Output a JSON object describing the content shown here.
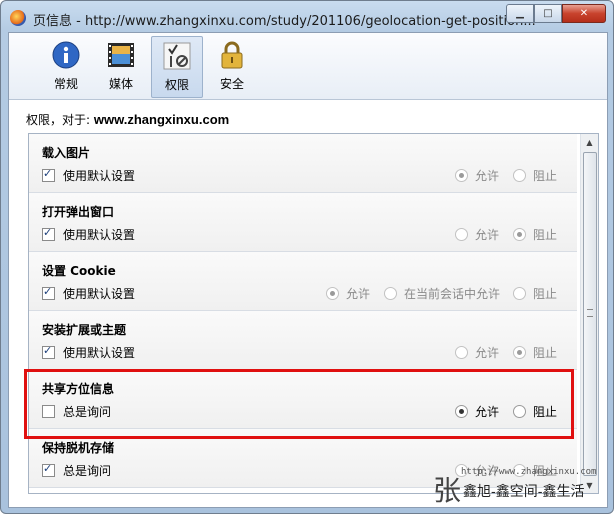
{
  "window": {
    "title": "页信息 - http://www.zhangxinxu.com/study/201106/geolocation-get-position...",
    "min_label": "▁",
    "max_label": "□",
    "close_label": "✕"
  },
  "toolbar": {
    "tabs": [
      {
        "label": "常规",
        "icon": "info-icon"
      },
      {
        "label": "媒体",
        "icon": "media-icon"
      },
      {
        "label": "权限",
        "icon": "permissions-icon",
        "active": true
      },
      {
        "label": "安全",
        "icon": "lock-icon"
      }
    ]
  },
  "permissions_for": {
    "label": "权限，对于:",
    "site": "www.zhangxinxu.com"
  },
  "sections": [
    {
      "title": "载入图片",
      "checkbox": "使用默认设置",
      "checked": true,
      "options": [
        "允许",
        "阻止"
      ],
      "selected": "允许",
      "disabled": true
    },
    {
      "title": "打开弹出窗口",
      "checkbox": "使用默认设置",
      "checked": true,
      "options": [
        "允许",
        "阻止"
      ],
      "selected": "阻止",
      "disabled": true
    },
    {
      "title": "设置 Cookie",
      "checkbox": "使用默认设置",
      "checked": true,
      "options": [
        "允许",
        "在当前会话中允许",
        "阻止"
      ],
      "selected": "允许",
      "disabled": true
    },
    {
      "title": "安装扩展或主题",
      "checkbox": "使用默认设置",
      "checked": true,
      "options": [
        "允许",
        "阻止"
      ],
      "selected": "阻止",
      "disabled": true
    },
    {
      "title": "共享方位信息",
      "checkbox": "总是询问",
      "checked": false,
      "options": [
        "允许",
        "阻止"
      ],
      "selected": "允许",
      "disabled": false
    },
    {
      "title": "保持脱机存储",
      "checkbox": "总是询问",
      "checked": true,
      "options": [
        "允许",
        "阻止"
      ],
      "selected": "",
      "disabled": true
    }
  ],
  "watermark": {
    "url": "http://www.zhangxinxu.com",
    "name": "鑫旭-鑫空间-鑫生活",
    "mark": "张"
  },
  "colors": {
    "highlight": "#e01010",
    "close_button": "#c8432d"
  }
}
